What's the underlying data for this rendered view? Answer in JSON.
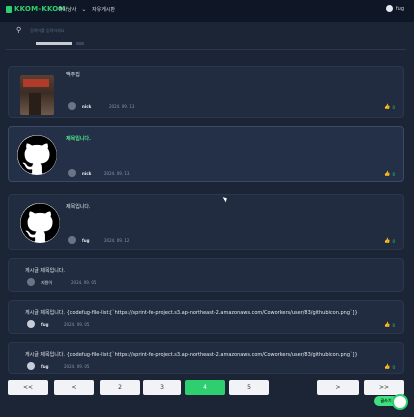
{
  "app": {
    "logo": "KKOM-KKOM",
    "nav_dropdown": "여사냥사",
    "nav_link": "자유게시판",
    "user_name": "fug"
  },
  "search": {
    "placeholder": "검색어를 입력하세요"
  },
  "posts": [
    {
      "title": "맥주집",
      "author": "nick",
      "date": "2024. 09. 13",
      "likes": "0",
      "thumbnail": "photo"
    },
    {
      "title": "제목입니다.",
      "author": "nick",
      "date": "2024. 09. 13",
      "likes": "0",
      "thumbnail": "github-icon",
      "highlight": true
    },
    {
      "title": "제목입니다.",
      "author": "fug",
      "date": "2024. 09. 12",
      "likes": "0",
      "thumbnail": "github-icon"
    },
    {
      "title": "게시글 제목입니다.",
      "author": "지원이",
      "date": "2024. 09. 05",
      "likes": "",
      "thumbnail": "none"
    },
    {
      "title": "게시글 제목입니다. {codefug-file-list:[`https://sprint-fe-project.s3.ap-northeast-2.amazonaws.com/Coworkers/user/83/githubicon.png`]}",
      "author": "fug",
      "date": "2024. 09. 05",
      "likes": "0",
      "thumbnail": "none"
    },
    {
      "title": "게시글 제목입니다. {codefug-file-list:[`https://sprint-fe-project.s3.ap-northeast-2.amazonaws.com/Coworkers/user/83/githubicon.png`]}",
      "author": "fug",
      "date": "2024. 09. 05",
      "likes": "0",
      "thumbnail": "none"
    }
  ],
  "pagination": {
    "first": "<<",
    "prev": "<",
    "pages": [
      "2",
      "3",
      "4",
      "5"
    ],
    "active_page": "4",
    "next": ">",
    "last": ">>"
  },
  "chat_fab": {
    "label": "글쓰기"
  },
  "colors": {
    "accent": "#2ecf6f",
    "background": "#1b2536",
    "card": "#212c40"
  }
}
